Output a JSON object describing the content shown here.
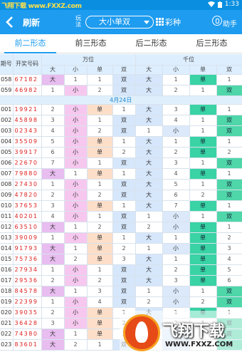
{
  "watermark": {
    "top_text": "飞翔下载 www.FXXZ.com",
    "logo_text": "飞翔下载",
    "url": "WWW.FXXZ.COM"
  },
  "status_bar": {
    "time": "1:33"
  },
  "toolbar": {
    "refresh_label": "刷新",
    "play_label": "玩法",
    "play_value": "大小单双",
    "lottery_label": "彩种",
    "helper_label": "助手"
  },
  "tabs": [
    {
      "label": "前二形态",
      "active": true
    },
    {
      "label": "前三形态",
      "active": false
    },
    {
      "label": "后二形态",
      "active": false
    },
    {
      "label": "后三形态",
      "active": false
    }
  ],
  "table": {
    "col_issue": "期号",
    "col_numbers": "开奖号码",
    "group_wan": "万位",
    "group_qian": "千位",
    "sub_headers": [
      "大",
      "小",
      "单",
      "双"
    ],
    "date_separator": "4月24日",
    "rows_before": [
      {
        "issue": "058",
        "numbers": "67182",
        "wan": [
          "大",
          "1",
          "1",
          "双"
        ],
        "qian": [
          "大",
          "1",
          "单",
          "1"
        ]
      },
      {
        "issue": "059",
        "numbers": "46982",
        "wan": [
          "1",
          "小",
          "2",
          "双"
        ],
        "qian": [
          "大",
          "2",
          "1",
          "双"
        ]
      }
    ],
    "rows": [
      {
        "issue": "001",
        "numbers": "19921",
        "wan": [
          "2",
          "小",
          "单",
          "1"
        ],
        "qian": [
          "大",
          "3",
          "单",
          "1"
        ]
      },
      {
        "issue": "002",
        "numbers": "45898",
        "wan": [
          "3",
          "小",
          "1",
          "双"
        ],
        "qian": [
          "大",
          "4",
          "1",
          "双"
        ]
      },
      {
        "issue": "003",
        "numbers": "02343",
        "wan": [
          "4",
          "小",
          "2",
          "双"
        ],
        "qian": [
          "1",
          "小",
          "1",
          "双"
        ]
      },
      {
        "issue": "004",
        "numbers": "35509",
        "wan": [
          "5",
          "小",
          "单",
          "1"
        ],
        "qian": [
          "大",
          "1",
          "单",
          "1"
        ]
      },
      {
        "issue": "005",
        "numbers": "39917",
        "wan": [
          "6",
          "小",
          "单",
          "2"
        ],
        "qian": [
          "大",
          "2",
          "单",
          "2"
        ]
      },
      {
        "issue": "006",
        "numbers": "22670",
        "wan": [
          "7",
          "小",
          "1",
          "双"
        ],
        "qian": [
          "大",
          "3",
          "1",
          "双"
        ]
      },
      {
        "issue": "007",
        "numbers": "79880",
        "wan": [
          "大",
          "1",
          "单",
          "1"
        ],
        "qian": [
          "大",
          "4",
          "单",
          "1"
        ]
      },
      {
        "issue": "008",
        "numbers": "27430",
        "wan": [
          "1",
          "小",
          "1",
          "双"
        ],
        "qian": [
          "大",
          "5",
          "1",
          "双"
        ]
      },
      {
        "issue": "009",
        "numbers": "47820",
        "wan": [
          "2",
          "小",
          "2",
          "双"
        ],
        "qian": [
          "大",
          "6",
          "2",
          "双"
        ]
      },
      {
        "issue": "010",
        "numbers": "37653",
        "wan": [
          "3",
          "小",
          "单",
          "1"
        ],
        "qian": [
          "大",
          "7",
          "单",
          "1"
        ]
      },
      {
        "issue": "011",
        "numbers": "40201",
        "wan": [
          "4",
          "小",
          "1",
          "双"
        ],
        "qian": [
          "1",
          "小",
          "1",
          "双"
        ]
      },
      {
        "issue": "012",
        "numbers": "63510",
        "wan": [
          "大",
          "1",
          "2",
          "双"
        ],
        "qian": [
          "2",
          "小",
          "单",
          "1"
        ]
      },
      {
        "issue": "013",
        "numbers": "39009",
        "wan": [
          "1",
          "小",
          "单",
          "1"
        ],
        "qian": [
          "大",
          "1",
          "单",
          "2"
        ]
      },
      {
        "issue": "014",
        "numbers": "91793",
        "wan": [
          "大",
          "1",
          "单",
          "2"
        ],
        "qian": [
          "1",
          "小",
          "单",
          "3"
        ]
      },
      {
        "issue": "015",
        "numbers": "75736",
        "wan": [
          "大",
          "2",
          "单",
          "3"
        ],
        "qian": [
          "大",
          "1",
          "单",
          "4"
        ]
      },
      {
        "issue": "016",
        "numbers": "27934",
        "wan": [
          "1",
          "小",
          "1",
          "双"
        ],
        "qian": [
          "大",
          "2",
          "单",
          "5"
        ]
      },
      {
        "issue": "017",
        "numbers": "29536",
        "wan": [
          "2",
          "小",
          "2",
          "双"
        ],
        "qian": [
          "大",
          "3",
          "单",
          "6"
        ]
      },
      {
        "issue": "018",
        "numbers": "84578",
        "wan": [
          "大",
          "1",
          "3",
          "双"
        ],
        "qian": [
          "1",
          "小",
          "1",
          "双"
        ]
      },
      {
        "issue": "019",
        "numbers": "22399",
        "wan": [
          "1",
          "小",
          "4",
          "双"
        ],
        "qian": [
          "2",
          "小",
          "2",
          "双"
        ]
      },
      {
        "issue": "020",
        "numbers": "39035",
        "wan": [
          "2",
          "小",
          "单",
          "1"
        ],
        "qian": [
          "大",
          "1",
          "单",
          "1"
        ]
      },
      {
        "issue": "021",
        "numbers": "36428",
        "wan": [
          "3",
          "小",
          "单",
          "2"
        ],
        "qian": [
          "大",
          "2",
          "1",
          "双"
        ]
      },
      {
        "issue": "022",
        "numbers": "74380",
        "wan": [
          "大",
          "1",
          "单",
          "3"
        ],
        "qian": [
          "1",
          "小",
          "2",
          "双"
        ]
      },
      {
        "issue": "023",
        "numbers": "83601",
        "wan": [
          "大",
          "2",
          "1",
          "双"
        ],
        "qian": [
          "1",
          "小",
          "1",
          "双"
        ]
      }
    ]
  }
}
